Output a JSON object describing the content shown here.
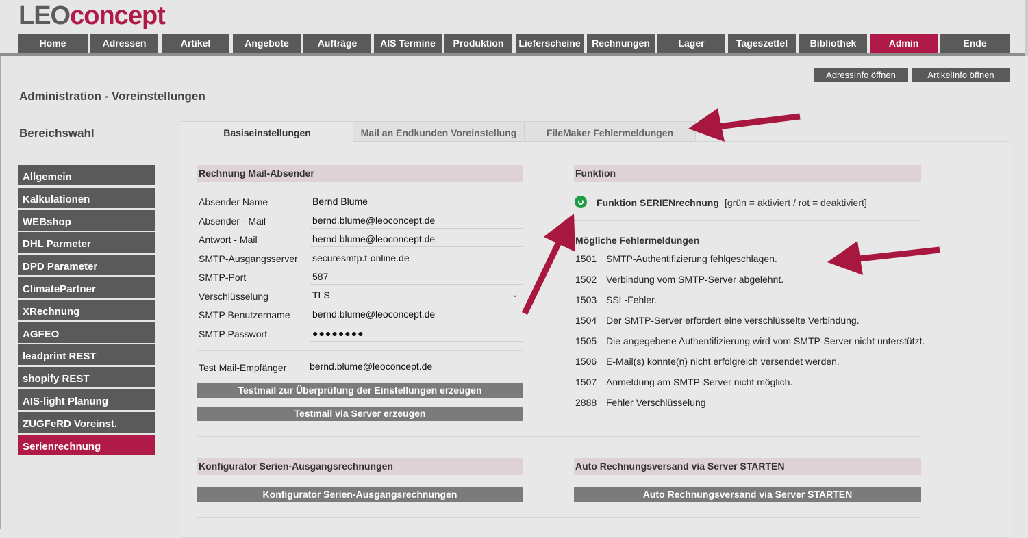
{
  "logo": {
    "part1": "LEO",
    "part2": "concept"
  },
  "colors": {
    "accent": "#b01a48",
    "nav": "#5a5a5a",
    "button": "#7b7b7b",
    "status_green": "#1e9e43"
  },
  "topnav": [
    "Home",
    "Adressen",
    "Artikel",
    "Angebote",
    "Aufträge",
    "AIS Termine",
    "Produktion",
    "Lieferscheine",
    "Rechnungen",
    "Lager",
    "Tageszettel",
    "Bibliothek",
    "Admin",
    "Ende"
  ],
  "topnav_active": "Admin",
  "info_buttons": {
    "adress": "AdressInfo öffnen",
    "artikel": "ArtikelInfo öffnen"
  },
  "page_title": "Administration - Voreinstellungen",
  "section_title": "Bereichswahl",
  "sidebar": [
    "Allgemein",
    "Kalkulationen",
    "WEBshop",
    "DHL Parmeter",
    "DPD Parameter",
    "ClimatePartner",
    "XRechnung",
    "AGFEO",
    "leadprint REST",
    "shopify REST",
    "AIS-light Planung",
    "ZUGFeRD Voreinst.",
    "Serienrechnung"
  ],
  "sidebar_active": "Serienrechnung",
  "tabs": [
    "Basiseinstellungen",
    "Mail an Endkunden Voreinstellung",
    "FileMaker Fehlermeldungen"
  ],
  "mail": {
    "header": "Rechnung Mail-Absender",
    "fields": [
      {
        "label": "Absender Name",
        "value": "Bernd Blume"
      },
      {
        "label": "Absender - Mail",
        "value": "bernd.blume@leoconcept.de"
      },
      {
        "label": "Antwort - Mail",
        "value": "bernd.blume@leoconcept.de"
      },
      {
        "label": "SMTP-Ausgangsserver",
        "value": "securesmtp.t-online.de"
      },
      {
        "label": "SMTP-Port",
        "value": "587"
      },
      {
        "label": "Verschlüsselung",
        "value": "TLS"
      },
      {
        "label": "SMTP Benutzername",
        "value": "bernd.blume@leoconcept.de"
      },
      {
        "label": "SMTP Passwort",
        "value": "●●●●●●●●"
      }
    ],
    "test_label": "Test Mail-Empfänger",
    "test_value": "bernd.blume@leoconcept.de",
    "btn_test": "Testmail zur Überprüfung der Einstellungen erzeugen",
    "btn_server": "Testmail via Server erzeugen"
  },
  "funktion": {
    "header": "Funktion",
    "label": "Funktion SERIENrechnung",
    "desc": "[grün = aktiviert / rot = deaktiviert]"
  },
  "errors": {
    "title": "Mögliche Fehlermeldungen",
    "items": [
      {
        "code": "1501",
        "text": "SMTP-Authentifizierung fehlgeschlagen."
      },
      {
        "code": "1502",
        "text": "Verbindung vom SMTP-Server abgelehnt."
      },
      {
        "code": "1503",
        "text": "SSL-Fehler."
      },
      {
        "code": "1504",
        "text": "Der SMTP-Server erfordert eine verschlüsselte Verbindung."
      },
      {
        "code": "1505",
        "text": "Die angegebene Authentifizierung wird vom SMTP-Server nicht unterstützt."
      },
      {
        "code": "1506",
        "text": "E-Mail(s) konnte(n) nicht erfolgreich versendet werden."
      },
      {
        "code": "1507",
        "text": "Anmeldung am SMTP-Server nicht möglich."
      },
      {
        "code": "2888",
        "text": "Fehler Verschlüsselung"
      }
    ]
  },
  "konfigurator": {
    "header": "Konfigurator Serien-Ausgangsrechnungen",
    "button": "Konfigurator Serien-Ausgangsrechnungen"
  },
  "auto": {
    "header": "Auto Rechnungsversand via Server STARTEN",
    "button": "Auto Rechnungsversand via Server STARTEN"
  }
}
